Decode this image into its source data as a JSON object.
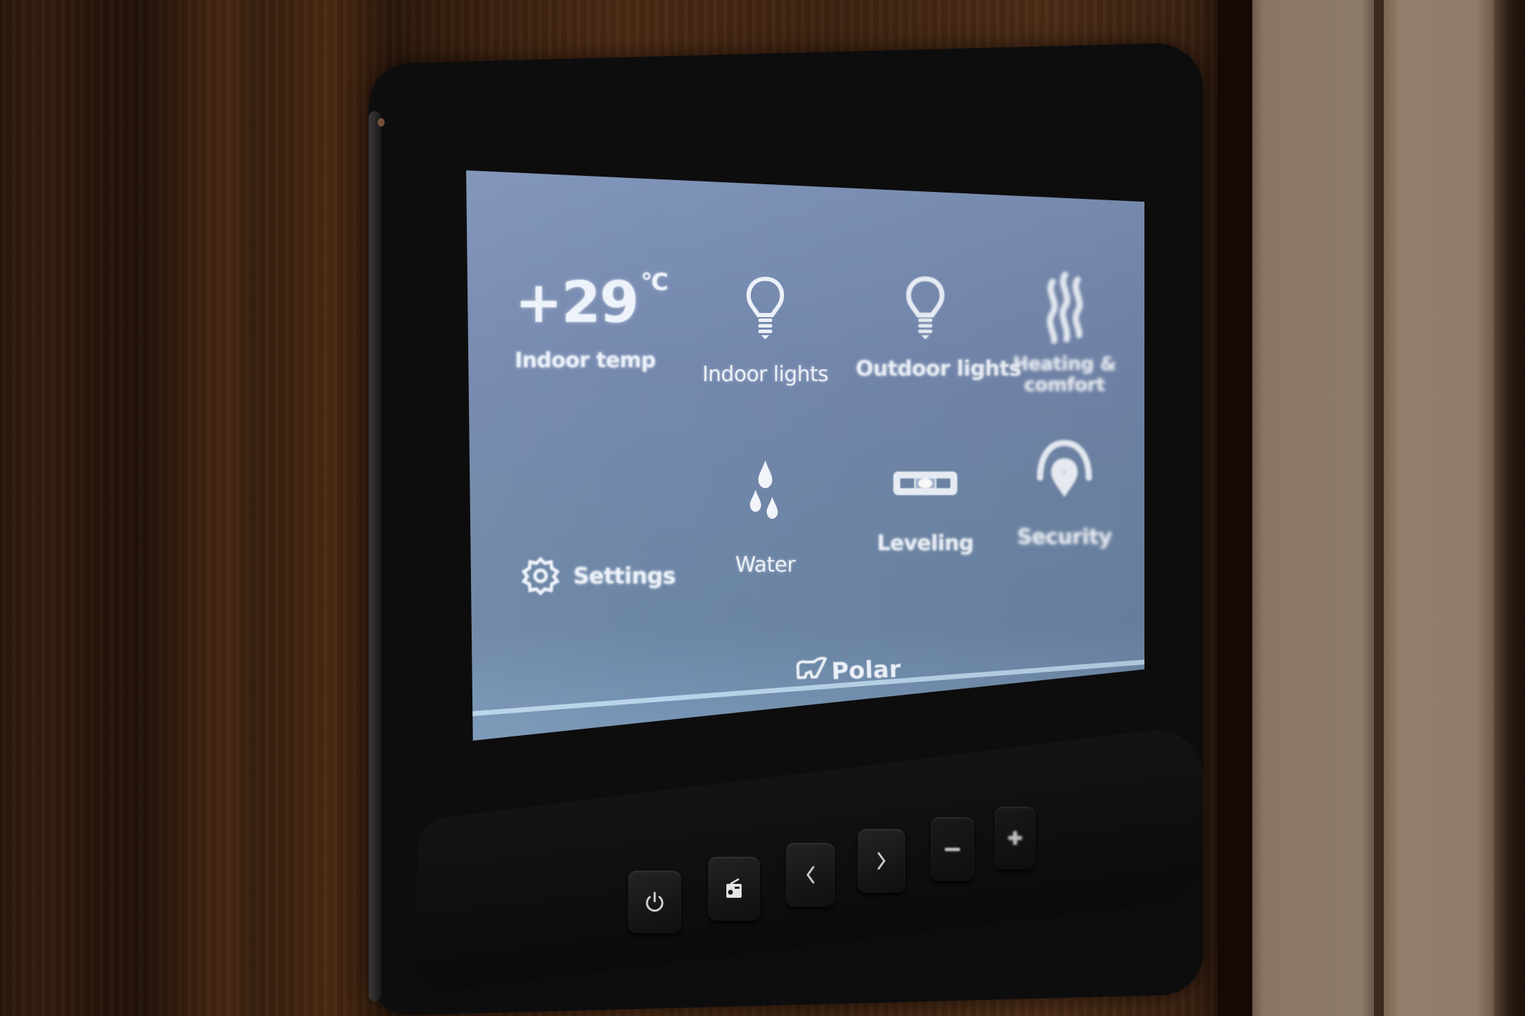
{
  "screen": {
    "colors": {
      "background": "#7489ac",
      "foreground": "#eef3fb",
      "divider": "#b9d3ea"
    },
    "tiles": [
      {
        "id": "indoor-temp",
        "value": "+29",
        "unit": "°C",
        "label": "Indoor temp"
      },
      {
        "id": "indoor-lights",
        "icon": "lightbulb-icon",
        "label": "Indoor lights"
      },
      {
        "id": "outdoor-lights",
        "icon": "lightbulb-icon",
        "label": "Outdoor lights"
      },
      {
        "id": "heating-comfort",
        "icon": "heat-waves-icon",
        "label_line1": "Heating &",
        "label_line2": "comfort"
      },
      {
        "id": "settings",
        "icon": "gear-icon",
        "label": "Settings"
      },
      {
        "id": "water",
        "icon": "water-drops-icon",
        "label": "Water"
      },
      {
        "id": "leveling",
        "icon": "spirit-level-icon",
        "label": "Leveling"
      },
      {
        "id": "security",
        "icon": "location-shield-icon",
        "label": "Security"
      }
    ],
    "brand": {
      "icon": "polar-bear-icon",
      "name": "Polar"
    }
  },
  "hardware_buttons": [
    {
      "id": "power",
      "icon": "power-icon"
    },
    {
      "id": "radio",
      "icon": "radio-icon"
    },
    {
      "id": "previous",
      "icon": "chevron-left-icon"
    },
    {
      "id": "next",
      "icon": "chevron-right-icon"
    },
    {
      "id": "minus",
      "icon": "minus-icon"
    },
    {
      "id": "plus",
      "icon": "plus-icon"
    }
  ]
}
